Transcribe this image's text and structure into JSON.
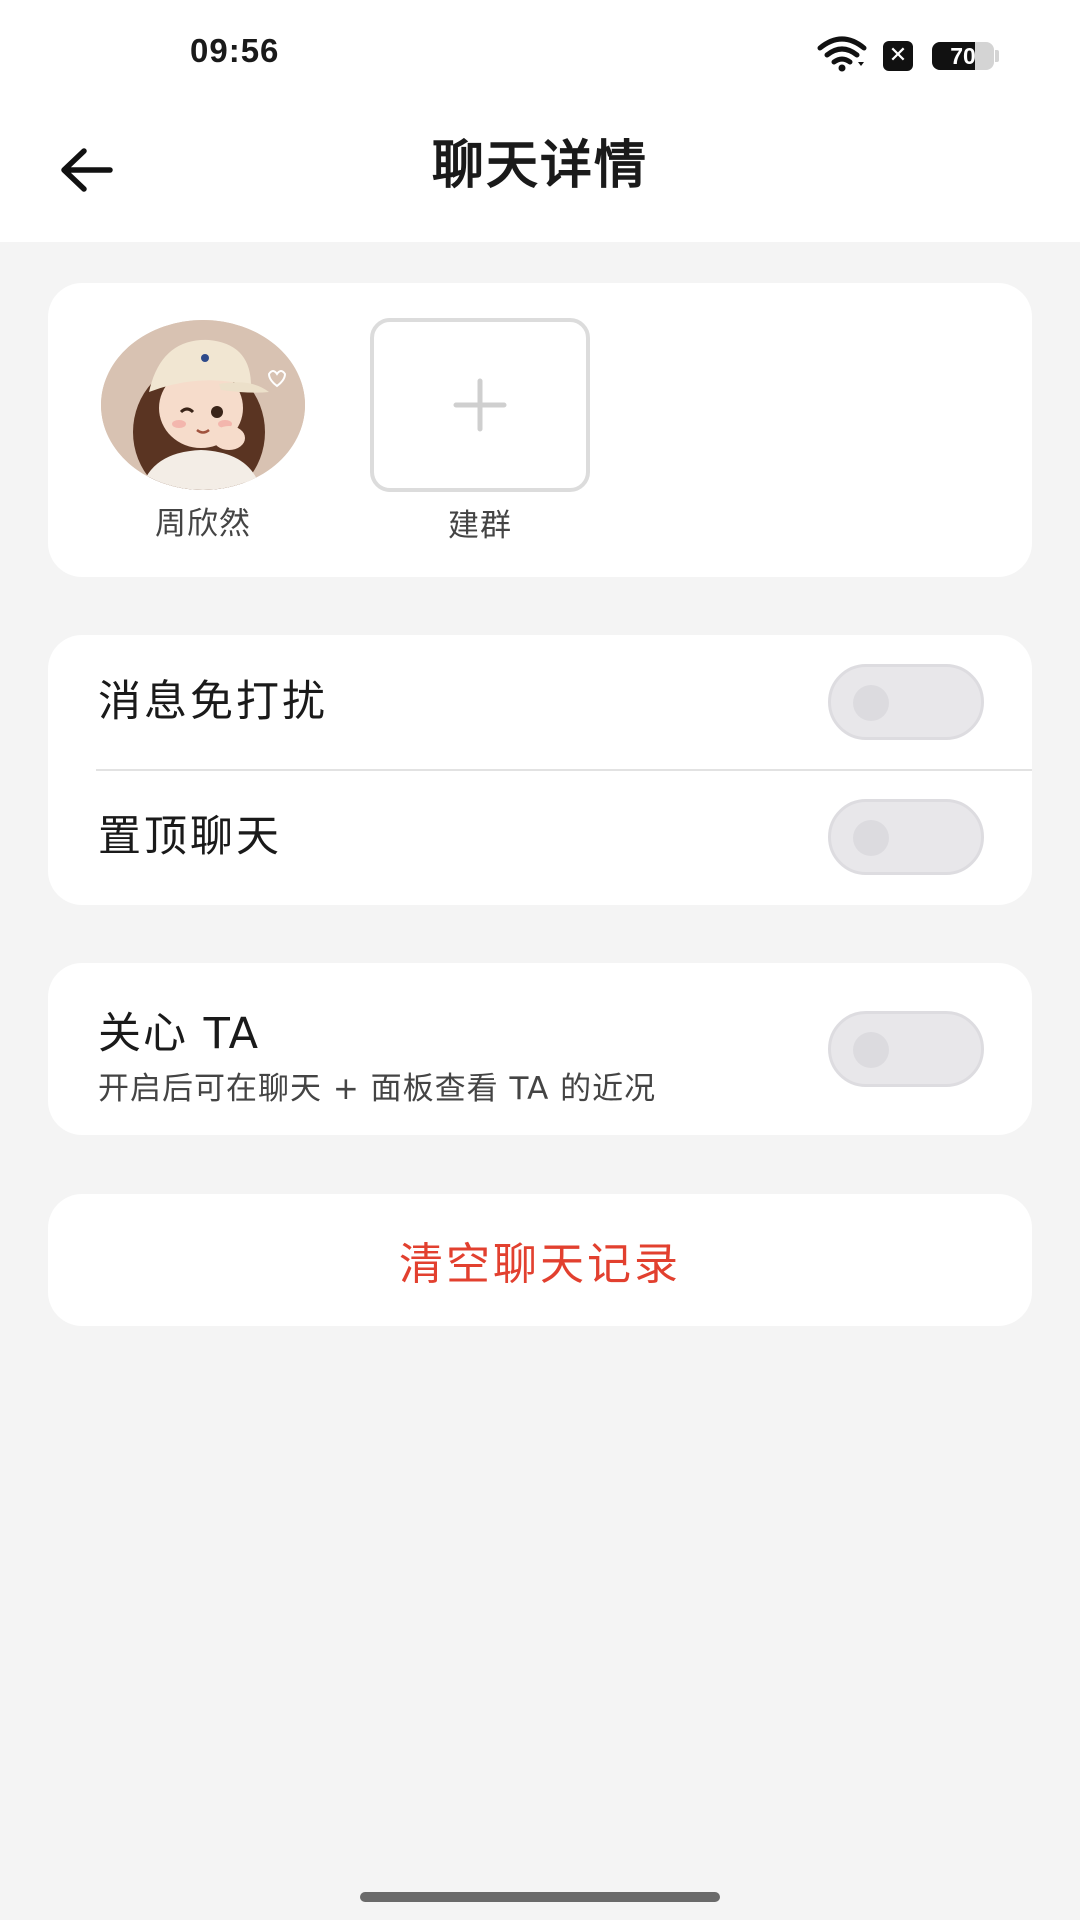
{
  "status_bar": {
    "time": "09:56",
    "battery_level": 70,
    "battery_text": "70",
    "icons": [
      "wifi-icon",
      "sim-disabled-icon",
      "battery-icon"
    ]
  },
  "header": {
    "title": "聊天详情",
    "back_icon": "arrow-left-icon"
  },
  "members": {
    "items": [
      {
        "name": "周欣然",
        "avatar": "cartoon-girl-avatar"
      },
      {
        "name": "建群",
        "icon": "plus-icon"
      }
    ]
  },
  "settings": {
    "mute": {
      "label": "消息免打扰",
      "on": false
    },
    "pin": {
      "label": "置顶聊天",
      "on": false
    }
  },
  "care": {
    "title": "关心 TA",
    "subtitle": "开启后可在聊天 + 面板查看 TA 的近况",
    "on": false
  },
  "clear_history": {
    "label": "清空聊天记录",
    "color": "#e2402f"
  },
  "colors": {
    "background": "#f4f4f4",
    "card": "#ffffff",
    "toggle_off": "#e8e7ea",
    "danger": "#e2402f"
  }
}
